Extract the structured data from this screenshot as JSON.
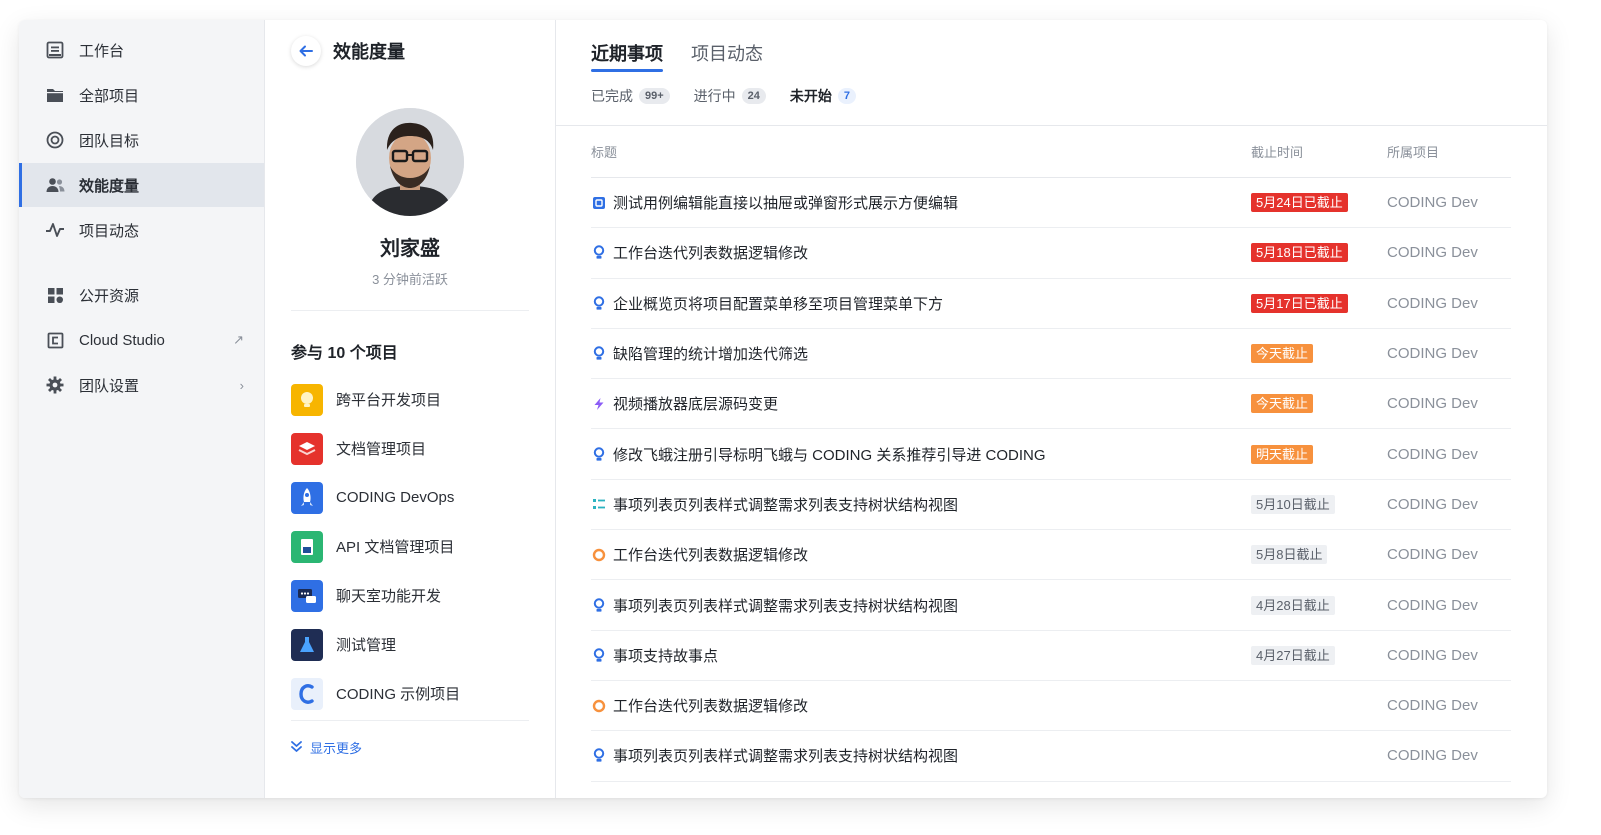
{
  "nav": {
    "items": [
      {
        "label": "工作台",
        "icon": "workbench-icon"
      },
      {
        "label": "全部项目",
        "icon": "folder-icon"
      },
      {
        "label": "团队目标",
        "icon": "target-icon"
      },
      {
        "label": "效能度量",
        "icon": "users-icon"
      },
      {
        "label": "项目动态",
        "icon": "activity-icon"
      }
    ],
    "items2": [
      {
        "label": "公开资源",
        "icon": "grid-icon"
      },
      {
        "label": "Cloud Studio",
        "icon": "cloud-studio-icon",
        "trail": "↗"
      },
      {
        "label": "团队设置",
        "icon": "gear-icon",
        "trail": "›"
      }
    ]
  },
  "profile": {
    "title": "效能度量",
    "name": "刘家盛",
    "status": "3 分钟前活跃",
    "projects_heading": "参与 10 个项目",
    "projects": [
      {
        "label": "跨平台开发项目",
        "color": "#f7b500"
      },
      {
        "label": "文档管理项目",
        "color": "#e5322c"
      },
      {
        "label": "CODING DevOps",
        "color": "#2f6fe4"
      },
      {
        "label": "API 文档管理项目",
        "color": "#2bb673"
      },
      {
        "label": "聊天室功能开发",
        "color": "#2f6fe4"
      },
      {
        "label": "测试管理",
        "color": "#1f2d54"
      },
      {
        "label": "CODING 示例项目",
        "color": "#e9f0fb"
      }
    ],
    "show_more": "显示更多"
  },
  "main": {
    "tabs": [
      {
        "label": "近期事项"
      },
      {
        "label": "项目动态"
      }
    ],
    "filters": [
      {
        "label": "已完成",
        "count": "99+"
      },
      {
        "label": "进行中",
        "count": "24"
      },
      {
        "label": "未开始",
        "count": "7"
      }
    ],
    "columns": {
      "title": "标题",
      "deadline": "截止时间",
      "project": "所属项目"
    },
    "rows": [
      {
        "title": "测试用例编辑能直接以抽屉或弹窗形式展示方便编辑",
        "type": "testcase",
        "deadline": "5月24日已截止",
        "status": "overdue",
        "project": "CODING Dev"
      },
      {
        "title": "工作台迭代列表数据逻辑修改",
        "type": "requirement",
        "deadline": "5月18日已截止",
        "status": "overdue",
        "project": "CODING Dev"
      },
      {
        "title": "企业概览页将项目配置菜单移至项目管理菜单下方",
        "type": "requirement",
        "deadline": "5月17日已截止",
        "status": "overdue",
        "project": "CODING Dev"
      },
      {
        "title": "缺陷管理的统计增加迭代筛选",
        "type": "requirement",
        "deadline": "今天截止",
        "status": "today",
        "project": "CODING Dev"
      },
      {
        "title": "视频播放器底层源码变更",
        "type": "epic",
        "deadline": "今天截止",
        "status": "today",
        "project": "CODING Dev"
      },
      {
        "title": "修改飞蛾注册引导标明飞蛾与 CODING 关系推荐引导进 CODING",
        "type": "requirement",
        "deadline": "明天截止",
        "status": "today",
        "project": "CODING Dev"
      },
      {
        "title": "事项列表页列表样式调整需求列表支持树状结构视图",
        "type": "subtask",
        "deadline": "5月10日截止",
        "status": "normal",
        "project": "CODING Dev"
      },
      {
        "title": "工作台迭代列表数据逻辑修改",
        "type": "task",
        "deadline": "5月8日截止",
        "status": "normal",
        "project": "CODING Dev"
      },
      {
        "title": "事项列表页列表样式调整需求列表支持树状结构视图",
        "type": "requirement",
        "deadline": "4月28日截止",
        "status": "normal",
        "project": "CODING Dev"
      },
      {
        "title": "事项支持故事点",
        "type": "requirement",
        "deadline": "4月27日截止",
        "status": "normal",
        "project": "CODING Dev"
      },
      {
        "title": "工作台迭代列表数据逻辑修改",
        "type": "task",
        "deadline": "",
        "status": "none",
        "project": "CODING Dev"
      },
      {
        "title": "事项列表页列表样式调整需求列表支持树状结构视图",
        "type": "requirement",
        "deadline": "",
        "status": "none",
        "project": "CODING Dev"
      }
    ]
  }
}
